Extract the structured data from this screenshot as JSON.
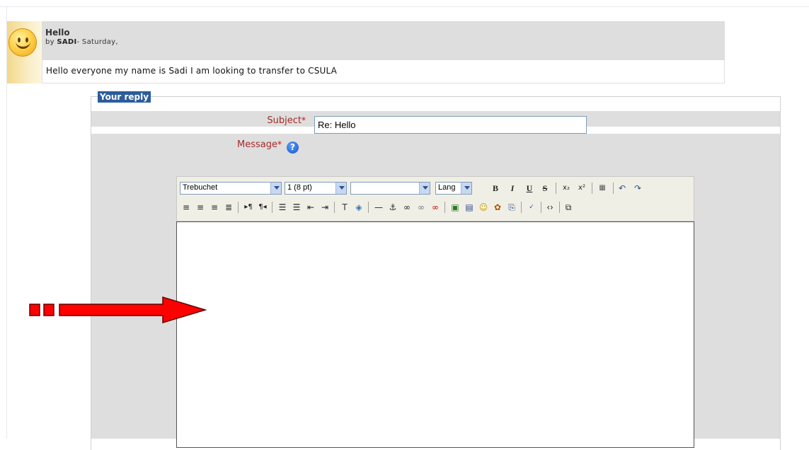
{
  "post": {
    "subject": "Hello",
    "author_prefix": "by ",
    "author": "SADI",
    "date": "- Saturday,",
    "message": "Hello everyone my name is Sadi I am looking to transfer to CSULA"
  },
  "reply": {
    "legend": "Your reply",
    "subject_label": "Subject",
    "message_label": "Message",
    "required_mark": "*",
    "subject_value": "Re: Hello"
  },
  "toolbar": {
    "font": "Trebuchet",
    "size": "1 (8 pt)",
    "format": "",
    "lang": "Lang",
    "bold": "B",
    "italic": "I",
    "underline": "U",
    "strike": "S"
  },
  "colors": {
    "legend_bg": "#2c5c9c",
    "header_bg": "#dedede",
    "label": "#a52a2a",
    "arrow": "#ff0000"
  }
}
